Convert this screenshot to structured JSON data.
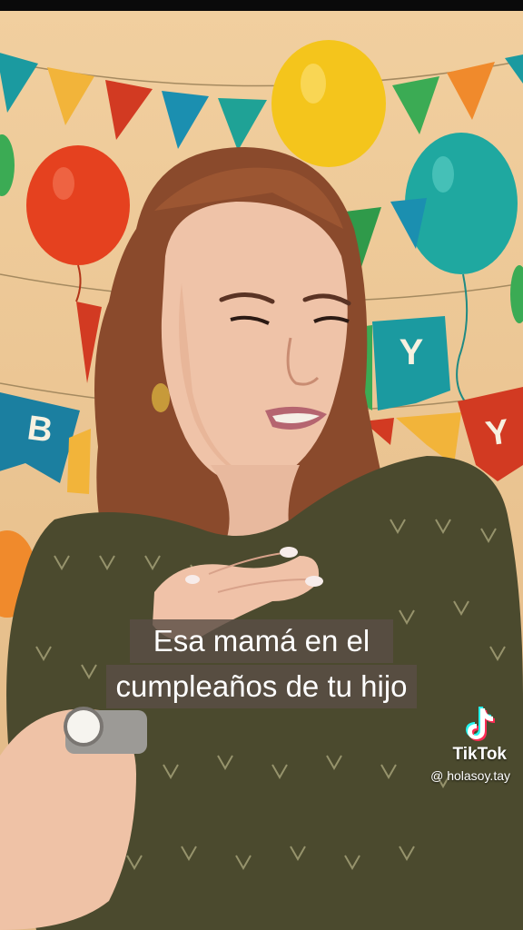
{
  "video": {
    "caption_line_1": "Esa mamá en el",
    "caption_line_2": "cumpleaños de tu hijo"
  },
  "watermark": {
    "brand": "TikTok",
    "handle": "@ holasoy.tay",
    "logo_icon": "tiktok-note-icon"
  },
  "banner_letters": {
    "left_letter": "B",
    "right_letter_1": "Y",
    "right_letter_2": "Y"
  },
  "colors": {
    "wall": "#f1cf9f",
    "caption_bg": "#5a4e46",
    "balloon_yellow": "#f4c51c",
    "balloon_red": "#e5411f",
    "balloon_teal": "#1fa8a0",
    "flag_teal": "#1b9aa0",
    "flag_red": "#d23a22",
    "flag_orange": "#f08a2c"
  }
}
